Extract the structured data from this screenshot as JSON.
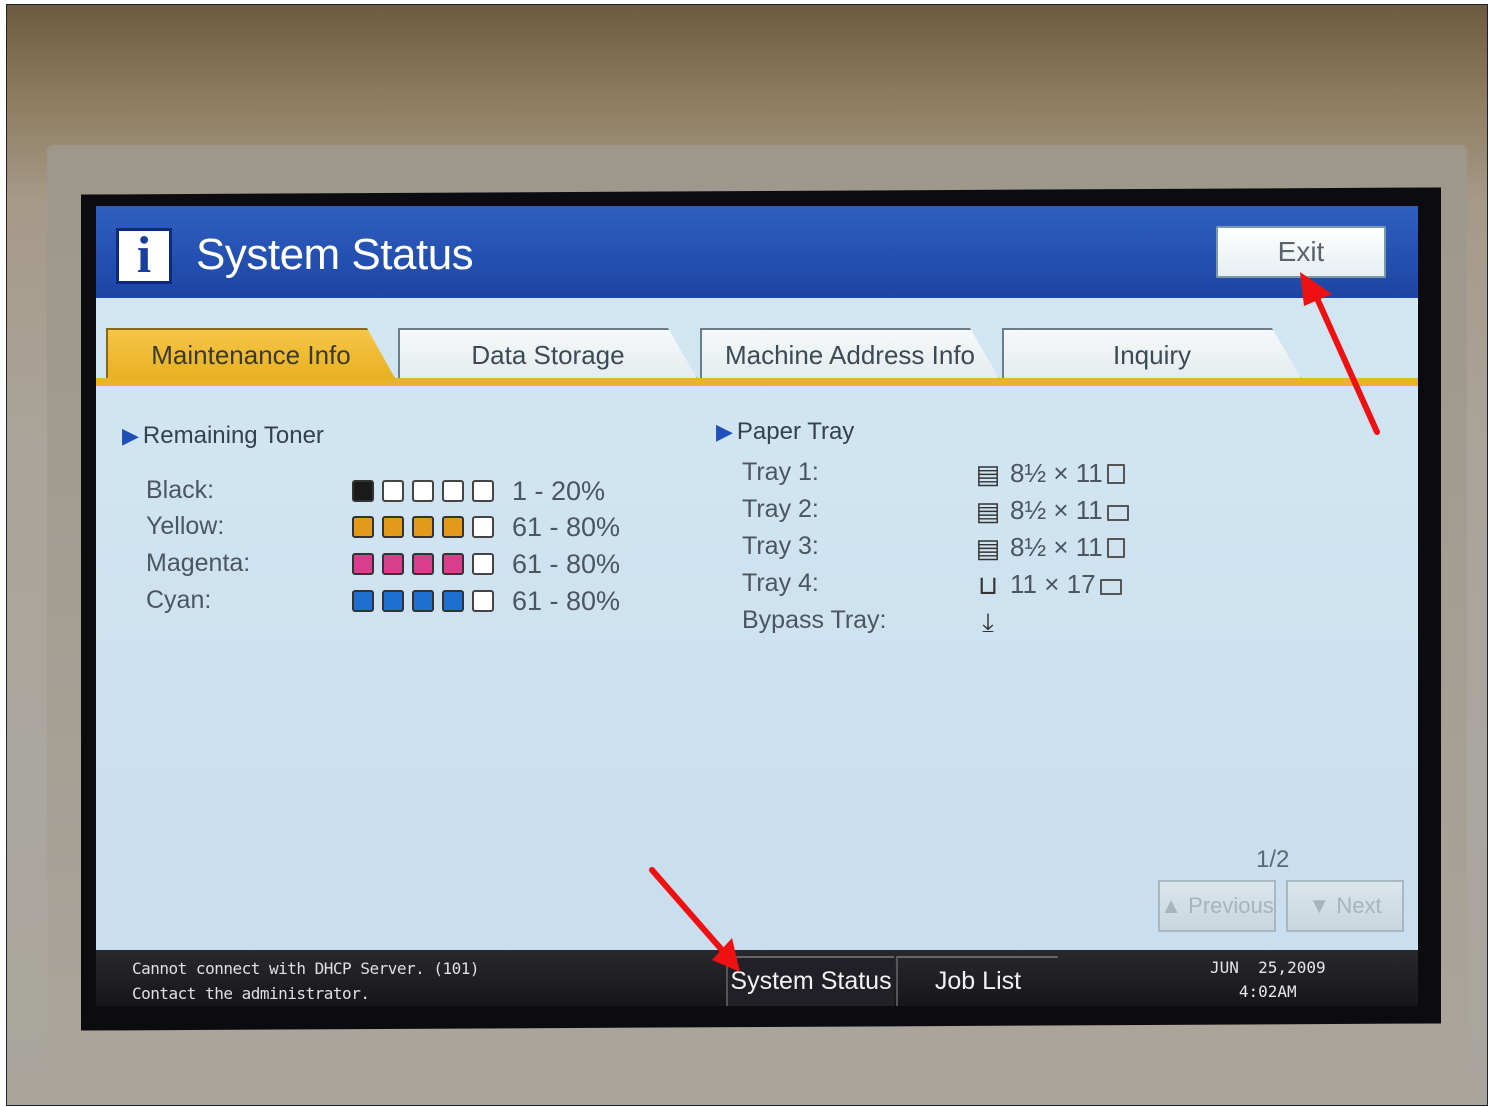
{
  "header": {
    "title": "System Status",
    "exit_label": "Exit"
  },
  "tabs": [
    {
      "label": "Maintenance Info",
      "active": true
    },
    {
      "label": "Data Storage",
      "active": false
    },
    {
      "label": "Machine Address Info",
      "active": false
    },
    {
      "label": "Inquiry",
      "active": false
    }
  ],
  "toner": {
    "heading": "Remaining Toner",
    "rows": [
      {
        "label": "Black:",
        "range": "1 - 20%",
        "filled": 1,
        "color": "#1a1a1a"
      },
      {
        "label": "Yellow:",
        "range": "61 - 80%",
        "filled": 4,
        "color": "#e39a1c"
      },
      {
        "label": "Magenta:",
        "range": "61 - 80%",
        "filled": 4,
        "color": "#d83d8e"
      },
      {
        "label": "Cyan:",
        "range": "61 - 80%",
        "filled": 4,
        "color": "#1e6fd0"
      }
    ]
  },
  "paper": {
    "heading": "Paper Tray",
    "rows": [
      {
        "label": "Tray 1:",
        "size": "8½ × 11",
        "icon": "paper-stack-icon",
        "orientation": "portrait"
      },
      {
        "label": "Tray 2:",
        "size": "8½ × 11",
        "icon": "paper-stack-icon",
        "orientation": "landscape"
      },
      {
        "label": "Tray 3:",
        "size": "8½ × 11",
        "icon": "paper-stack-icon",
        "orientation": "portrait"
      },
      {
        "label": "Tray 4:",
        "size": "11 × 17",
        "icon": "empty-tray-icon",
        "orientation": "landscape"
      },
      {
        "label": "Bypass Tray:",
        "size": "",
        "icon": "bypass-tray-icon",
        "orientation": ""
      }
    ]
  },
  "pager": {
    "page": "1/2",
    "previous_label": "Previous",
    "next_label": "Next"
  },
  "statusbar": {
    "message_line1": "Cannot connect with DHCP Server. (101)",
    "message_line2": "Contact the administrator.",
    "tab_system_status": "System Status",
    "tab_job_list": "Job List",
    "date": "JUN  25,2009",
    "time": "4:02AM"
  },
  "colors": {
    "header_blue": "#1c45a5",
    "tab_yellow": "#e8b42a",
    "annotation_red": "#ee1111"
  }
}
